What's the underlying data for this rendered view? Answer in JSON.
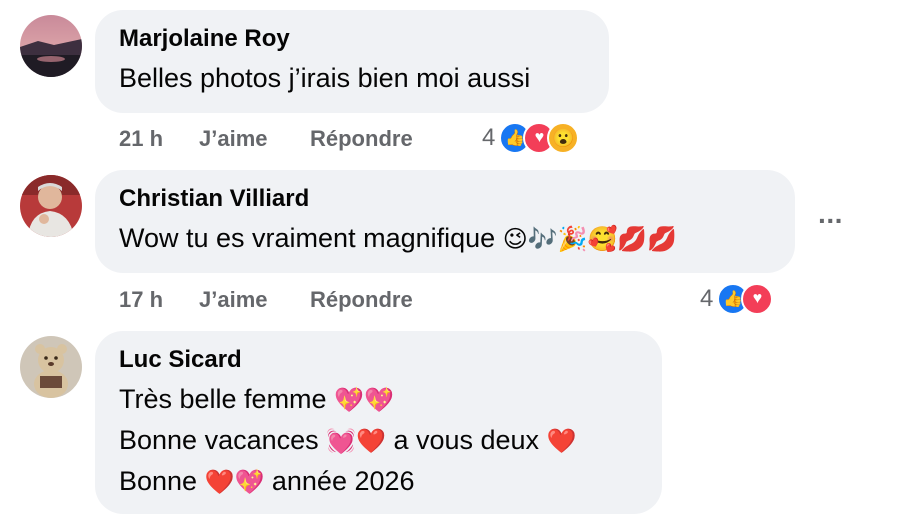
{
  "comments": [
    {
      "author": "Marjolaine Roy",
      "lines": [
        "Belles photos j’irais bien moi aussi"
      ],
      "time": "21 h",
      "like_label": "J’aime",
      "reply_label": "Répondre",
      "reaction_count": "4",
      "reactions": [
        "like-icon",
        "love-icon",
        "wow-icon"
      ]
    },
    {
      "author": "Christian Villiard",
      "lines": [
        "Wow tu es vraiment magnifique"
      ],
      "line_emojis": "😉🎶🎉🥰💋💋",
      "time": "17 h",
      "like_label": "J’aime",
      "reply_label": "Répondre",
      "reaction_count": "4",
      "reactions": [
        "like-icon",
        "love-icon"
      ]
    },
    {
      "author": "Luc Sicard",
      "lines": [
        {
          "text": "Très belle femme",
          "emoji": "💖💖"
        },
        {
          "text_a": "Bonne vacances",
          "emoji_a": "💓❤️",
          "text_b": "a vous deux",
          "emoji_b": "❤️"
        },
        {
          "text_a": "Bonne",
          "emoji_a": "❤️💖",
          "text_b": "année 2026"
        }
      ]
    }
  ],
  "more_icon": "more-options-icon",
  "colors": {
    "bubble": "#f0f2f5",
    "meta": "#65676b",
    "like": "#1877f2",
    "love": "#f33e58",
    "wow": "#f7b125"
  }
}
